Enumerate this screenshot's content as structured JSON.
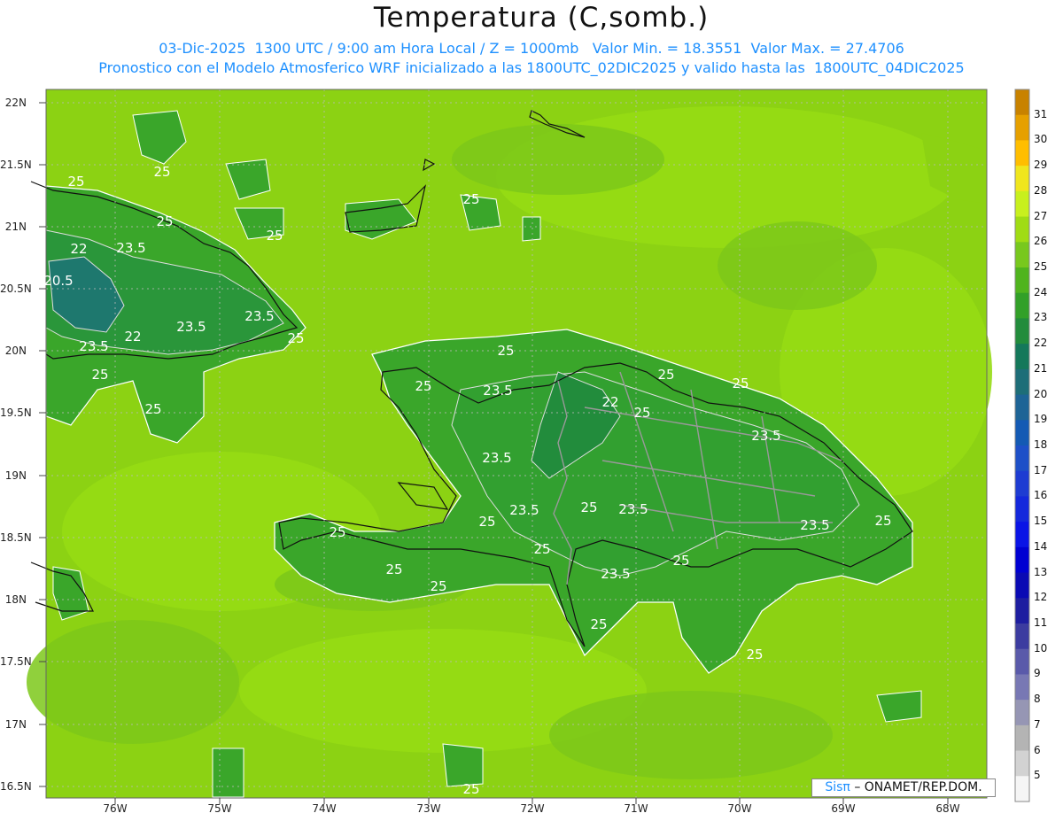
{
  "title": "Temperatura (C,somb.)",
  "subtitle_line1": "03-Dic-2025  1300 UTC / 9:00 am Hora Local / Z = 1000mb   Valor Min. = 18.3551  Valor Max. = 27.4706",
  "subtitle_line2": "Pronostico con el Modelo Atmosferico WRF inicializado a las 1800UTC_02DIC2025 y valido hasta las  1800UTC_04DIC2025",
  "lat_labels": [
    "22N",
    "21.5N",
    "21N",
    "20.5N",
    "20N",
    "19.5N",
    "19N",
    "18.5N",
    "18N",
    "17.5N",
    "17N",
    "16.5N"
  ],
  "lon_labels": [
    "76W",
    "75W",
    "74W",
    "73W",
    "72W",
    "71W",
    "70W",
    "69W",
    "68W"
  ],
  "colorbar": {
    "labels": [
      "31",
      "30",
      "29",
      "28",
      "27",
      "26",
      "25",
      "24",
      "23",
      "22",
      "21",
      "20",
      "19",
      "18",
      "17",
      "16",
      "15",
      "14",
      "13",
      "12",
      "11",
      "10",
      "9",
      "8",
      "7",
      "6",
      "5"
    ],
    "colors": [
      "#c88200",
      "#e6a000",
      "#ffbe00",
      "#f0e61e",
      "#c8f01e",
      "#a0dc14",
      "#78c81e",
      "#50b41e",
      "#32a028",
      "#228c3c",
      "#14785a",
      "#1e6e78",
      "#1e6496",
      "#145ab4",
      "#1e50c8",
      "#1e3cd2",
      "#1428dc",
      "#0a14e6",
      "#0000d2",
      "#0a0ab4",
      "#1e1ea0",
      "#3c3ca0",
      "#5a5aaa",
      "#7878b4",
      "#9696b4",
      "#b4b4b4",
      "#d2d2d2",
      "#f5f5f5"
    ]
  },
  "contour_labels": [
    "25",
    "23.5",
    "22",
    "20.5"
  ],
  "credit": {
    "logo": "Sisπ",
    "text": "– ONAMET/REP.DOM."
  }
}
